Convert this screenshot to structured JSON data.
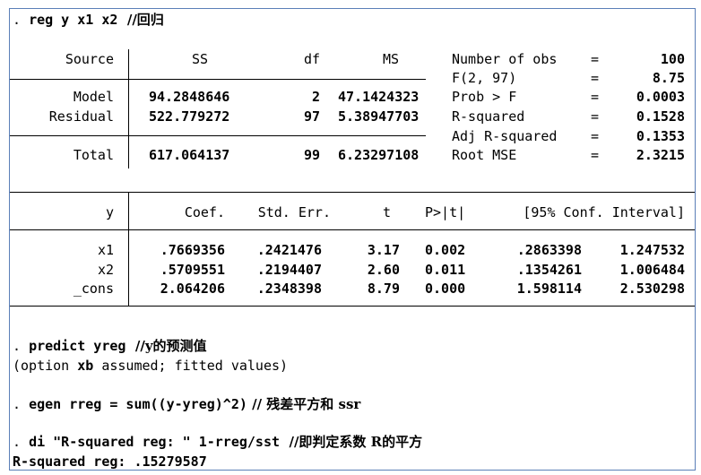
{
  "commands": {
    "reg": {
      "prefix": ". ",
      "cmd": "reg y x1 x2",
      "comment": "  //回归"
    },
    "predict": {
      "prefix": ". ",
      "cmd": "predict yreg",
      "comment": "  //y的预测值"
    },
    "predict_note": {
      "pre": "(option ",
      "bold": "xb",
      "post": " assumed; fitted values)"
    },
    "egen": {
      "prefix": ". ",
      "cmd": "egen rreg = sum((y-yreg)^2)",
      "comment": " // 残差平方和 ssr"
    },
    "di": {
      "prefix": ". ",
      "cmd": "di \"R-squared reg: \" 1-rreg/sst",
      "comment": "  //即判定系数 R的平方"
    },
    "di_result": "R-squared reg: .15279587"
  },
  "anova": {
    "headers": {
      "source": "Source",
      "ss": "SS",
      "df": "df",
      "ms": "MS"
    },
    "rows": [
      {
        "source": "Model",
        "ss": "94.2848646",
        "df": "2",
        "ms": "47.1424323"
      },
      {
        "source": "Residual",
        "ss": "522.779272",
        "df": "97",
        "ms": "5.38947703"
      },
      {
        "source": "Total",
        "ss": "617.064137",
        "df": "99",
        "ms": "6.23297108"
      }
    ]
  },
  "stats": [
    {
      "label": "Number of obs",
      "eq": "=",
      "value": "100"
    },
    {
      "label": "F(2, 97)",
      "eq": "=",
      "value": "8.75"
    },
    {
      "label": "Prob > F",
      "eq": "=",
      "value": "0.0003"
    },
    {
      "label": "R-squared",
      "eq": "=",
      "value": "0.1528"
    },
    {
      "label": "Adj R-squared",
      "eq": "=",
      "value": "0.1353"
    },
    {
      "label": "Root MSE",
      "eq": "=",
      "value": "2.3215"
    }
  ],
  "coef": {
    "headers": {
      "var": "y",
      "coef": "Coef.",
      "se": "Std. Err.",
      "t": "t",
      "p": "P>|t|",
      "ci": "[95% Conf. Interval]"
    },
    "rows": [
      {
        "var": "x1",
        "coef": ".7669356",
        "se": ".2421476",
        "t": "3.17",
        "p": "0.002",
        "lo": ".2863398",
        "hi": "1.247532"
      },
      {
        "var": "x2",
        "coef": ".5709551",
        "se": ".2194407",
        "t": "2.60",
        "p": "0.011",
        "lo": ".1354261",
        "hi": "1.006484"
      },
      {
        "var": "_cons",
        "coef": "2.064206",
        "se": ".2348398",
        "t": "8.79",
        "p": "0.000",
        "lo": "1.598114",
        "hi": "2.530298"
      }
    ]
  },
  "colors": {
    "frame_border": "#5b7fb8",
    "text": "#000000",
    "background": "#ffffff"
  }
}
